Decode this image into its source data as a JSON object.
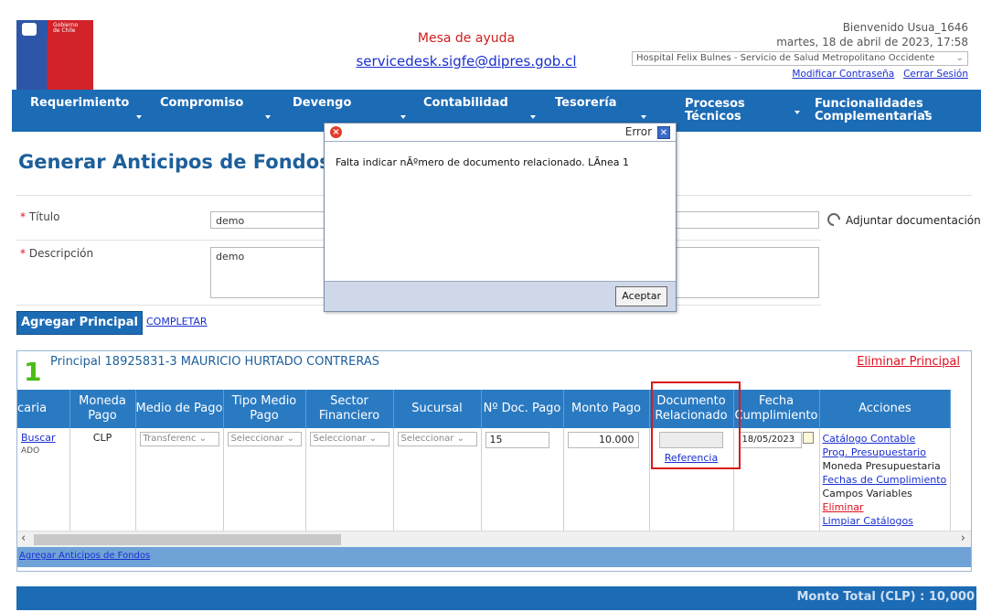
{
  "header": {
    "logo_text_line1": "Gobierno",
    "logo_text_line2": "de Chile",
    "help_title": "Mesa de ayuda",
    "help_email": "servicedesk.sigfe@dipres.gob.cl",
    "welcome": "Bienvenido Usua_1646",
    "date": "martes, 18 de abril de 2023, 17:58",
    "organization": "Hospital Felix Bulnes - Servicio de Salud Metropolitano Occidente",
    "change_password": "Modificar Contraseña",
    "logout": "Cerrar Sesión"
  },
  "nav": {
    "items": [
      {
        "label": "Requerimiento"
      },
      {
        "label": "Compromiso"
      },
      {
        "label": "Devengo"
      },
      {
        "label": "Contabilidad"
      },
      {
        "label": "Tesorería"
      },
      {
        "label": "Procesos\nTécnicos"
      },
      {
        "label": "Funcionalidades\nComplementarias"
      }
    ]
  },
  "form": {
    "page_title": "Generar Anticipos de Fondos",
    "titulo_label": "Título",
    "titulo_value": "demo",
    "descripcion_label": "Descripción",
    "descripcion_value": "demo",
    "attach_label": "Adjuntar documentación",
    "add_principal": "Agregar Principal",
    "complete": "COMPLETAR"
  },
  "principal": {
    "number": "1",
    "title": "Principal 18925831-3 MAURICIO HURTADO CONTRERAS",
    "delete": "Eliminar Principal",
    "columns": [
      "caria",
      "Moneda Pago",
      "Medio de Pago",
      "Tipo Medio Pago",
      "Sector Financiero",
      "Sucursal",
      "Nº Doc. Pago",
      "Monto Pago",
      "Documento Relacionado",
      "Fecha Cumplimiento",
      "Acciones"
    ],
    "row": {
      "buscar": "Buscar",
      "ado": "ADO",
      "moneda": "CLP",
      "medio": "Transferenc",
      "tipo_medio": "Seleccionar",
      "sector": "Seleccionar",
      "sucursal": "Seleccionar",
      "doc_pago": "15",
      "monto": "10.000",
      "referencia": "Referencia",
      "fecha": "18/05/2023",
      "acciones": [
        {
          "label": "Catálogo Contable",
          "type": "link"
        },
        {
          "label": "Prog. Presupuestario",
          "type": "link"
        },
        {
          "label": "Moneda Presupuestaria",
          "type": "text"
        },
        {
          "label": "Fechas de Cumplimiento",
          "type": "link"
        },
        {
          "label": "Campos Variables",
          "type": "text"
        },
        {
          "label": "Eliminar",
          "type": "red"
        },
        {
          "label": "Limpiar Catálogos",
          "type": "link"
        }
      ]
    },
    "add_anticipos": "Agregar Anticipos de Fondos"
  },
  "total": {
    "label": "Monto Total (CLP) : 10,000"
  },
  "dialog": {
    "title": "Error",
    "message": "Falta indicar nÃºmero de documento relacionado. LÃnea 1",
    "ok": "Aceptar"
  },
  "colors": {
    "nav_blue": "#1c6bb5",
    "title_blue": "#1c5f9a",
    "error_red": "#d12222",
    "highlight_red": "#d91a1a"
  }
}
